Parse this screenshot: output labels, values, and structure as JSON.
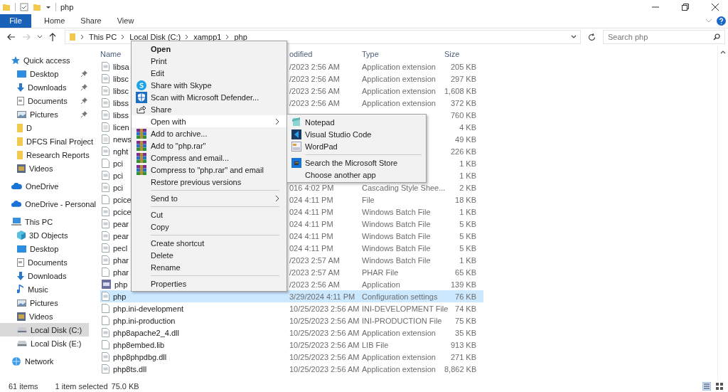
{
  "window": {
    "title": "php"
  },
  "ribbon": {
    "tabs": [
      {
        "label": "File",
        "kind": "file"
      },
      {
        "label": "Home",
        "kind": "tab"
      },
      {
        "label": "Share",
        "kind": "tab"
      },
      {
        "label": "View",
        "kind": "tab"
      }
    ]
  },
  "nav": {
    "back_disabled": false,
    "forward_disabled": true
  },
  "address": {
    "path": [
      "This PC",
      "Local Disk (C:)",
      "xampp1",
      "php"
    ]
  },
  "search": {
    "placeholder": "Search php"
  },
  "sidebar": {
    "sections": [
      {
        "label": "Quick access",
        "selected": false,
        "children": [
          {
            "label": "Desktop",
            "pinned": true,
            "selected": false
          },
          {
            "label": "Downloads",
            "pinned": true,
            "selected": false
          },
          {
            "label": "Documents",
            "pinned": true,
            "selected": false
          },
          {
            "label": "Pictures",
            "pinned": true,
            "selected": false
          },
          {
            "label": "D",
            "pinned": false,
            "selected": false
          },
          {
            "label": "DFCS Final Project",
            "pinned": false,
            "selected": false
          },
          {
            "label": "Research Reports",
            "pinned": false,
            "selected": false
          },
          {
            "label": "Videos",
            "pinned": false,
            "selected": false
          }
        ]
      },
      {
        "label": "OneDrive",
        "selected": false
      },
      {
        "label": "OneDrive - Personal",
        "selected": false
      },
      {
        "label": "This PC",
        "selected": false,
        "children": [
          {
            "label": "3D Objects",
            "selected": false
          },
          {
            "label": "Desktop",
            "selected": false
          },
          {
            "label": "Documents",
            "selected": false
          },
          {
            "label": "Downloads",
            "selected": false
          },
          {
            "label": "Music",
            "selected": false
          },
          {
            "label": "Pictures",
            "selected": false
          },
          {
            "label": "Videos",
            "selected": false
          },
          {
            "label": "Local Disk (C:)",
            "selected": true
          },
          {
            "label": "Local Disk (E:)",
            "selected": false
          }
        ]
      },
      {
        "label": "Network",
        "selected": false
      }
    ]
  },
  "file_list": {
    "columns": [
      "Name",
      "odified",
      "Type",
      "Size"
    ],
    "rows": [
      {
        "name": "libsa",
        "modified": "/2023 2:56 AM",
        "type": "Application extension",
        "size": "205 KB",
        "selected": false
      },
      {
        "name": "libsc",
        "modified": "/2023 2:56 AM",
        "type": "Application extension",
        "size": "297 KB",
        "selected": false
      },
      {
        "name": "libsc",
        "modified": "/2023 2:56 AM",
        "type": "Application extension",
        "size": "1,608 KB",
        "selected": false
      },
      {
        "name": "libss",
        "modified": "/2023 2:56 AM",
        "type": "Application extension",
        "size": "372 KB",
        "selected": false
      },
      {
        "name": "libss",
        "size": "760 KB",
        "selected": false
      },
      {
        "name": "licen",
        "size": "4 KB",
        "selected": false
      },
      {
        "name": "news",
        "size": "49 KB",
        "selected": false
      },
      {
        "name": "nght",
        "size": "226 KB",
        "selected": false
      },
      {
        "name": "pci",
        "size": "1 KB",
        "selected": false
      },
      {
        "name": "pci",
        "size": "1 KB",
        "selected": false
      },
      {
        "name": "pci",
        "modified": "016 4:02 PM",
        "type": "Cascading Style Shee...",
        "size": "2 KB",
        "selected": false
      },
      {
        "name": "pcice",
        "modified": "024 4:11 PM",
        "type": "File",
        "size": "18 KB",
        "selected": false
      },
      {
        "name": "pcice",
        "modified": "024 4:11 PM",
        "type": "Windows Batch File",
        "size": "1 KB",
        "selected": false
      },
      {
        "name": "pear",
        "modified": "024 4:11 PM",
        "type": "Windows Batch File",
        "size": "5 KB",
        "selected": false
      },
      {
        "name": "pear",
        "modified": "024 4:11 PM",
        "type": "Windows Batch File",
        "size": "5 KB",
        "selected": false
      },
      {
        "name": "pecl",
        "modified": "024 4:11 PM",
        "type": "Windows Batch File",
        "size": "5 KB",
        "selected": false
      },
      {
        "name": "phar",
        "modified": "/2023 2:57 AM",
        "type": "Windows Batch File",
        "size": "1 KB",
        "selected": false
      },
      {
        "name": "phar",
        "modified": "/2023 2:57 AM",
        "type": "PHAR File",
        "size": "65 KB",
        "selected": false
      },
      {
        "name": "php",
        "modified": "/2023 2:56 AM",
        "type": "Application",
        "size": "139 KB",
        "selected": false
      },
      {
        "name": "php",
        "modified": "3/29/2024 4:11 PM",
        "type": "Configuration settings",
        "size": "76 KB",
        "selected": true
      },
      {
        "name": "php.ini-development",
        "modified": "10/25/2023 2:56 AM",
        "type": "INI-DEVELOPMENT File",
        "size": "74 KB",
        "selected": false
      },
      {
        "name": "php.ini-production",
        "modified": "10/25/2023 2:56 AM",
        "type": "INI-PRODUCTION File",
        "size": "75 KB",
        "selected": false
      },
      {
        "name": "php8apache2_4.dll",
        "modified": "10/25/2023 2:56 AM",
        "type": "Application extension",
        "size": "35 KB",
        "selected": false
      },
      {
        "name": "php8embed.lib",
        "modified": "10/25/2023 2:56 AM",
        "type": "LIB File",
        "size": "913 KB",
        "selected": false
      },
      {
        "name": "php8phpdbg.dll",
        "modified": "10/25/2023 2:56 AM",
        "type": "Application extension",
        "size": "271 KB",
        "selected": false
      },
      {
        "name": "php8ts.dll",
        "modified": "10/25/2023 2:56 AM",
        "type": "Application extension",
        "size": "8,862 KB",
        "selected": false
      }
    ]
  },
  "context_menu": {
    "items": [
      {
        "kind": "item",
        "label": "Open",
        "default": true,
        "submenu": false,
        "selected": false
      },
      {
        "kind": "item",
        "label": "Print",
        "default": false,
        "submenu": false,
        "selected": false
      },
      {
        "kind": "item",
        "label": "Edit",
        "default": false,
        "submenu": false,
        "selected": false
      },
      {
        "kind": "item",
        "label": "Share with Skype",
        "default": false,
        "submenu": false,
        "selected": false
      },
      {
        "kind": "item",
        "label": "Scan with Microsoft Defender...",
        "default": false,
        "submenu": false,
        "selected": false
      },
      {
        "kind": "item",
        "label": "Share",
        "default": false,
        "submenu": false,
        "selected": false
      },
      {
        "kind": "item",
        "label": "Open with",
        "default": false,
        "submenu": true,
        "selected": true
      },
      {
        "kind": "item",
        "label": "Add to archive...",
        "default": false,
        "submenu": false,
        "selected": false
      },
      {
        "kind": "item",
        "label": "Add to \"php.rar\"",
        "default": false,
        "submenu": false,
        "selected": false
      },
      {
        "kind": "item",
        "label": "Compress and email...",
        "default": false,
        "submenu": false,
        "selected": false
      },
      {
        "kind": "item",
        "label": "Compress to \"php.rar\" and email",
        "default": false,
        "submenu": false,
        "selected": false
      },
      {
        "kind": "item",
        "label": "Restore previous versions",
        "default": false,
        "submenu": false,
        "selected": false
      },
      {
        "kind": "separator"
      },
      {
        "kind": "item",
        "label": "Send to",
        "default": false,
        "submenu": true,
        "selected": false
      },
      {
        "kind": "separator"
      },
      {
        "kind": "item",
        "label": "Cut",
        "default": false,
        "submenu": false,
        "selected": false
      },
      {
        "kind": "item",
        "label": "Copy",
        "default": false,
        "submenu": false,
        "selected": false
      },
      {
        "kind": "separator"
      },
      {
        "kind": "item",
        "label": "Create shortcut",
        "default": false,
        "submenu": false,
        "selected": false
      },
      {
        "kind": "item",
        "label": "Delete",
        "default": false,
        "submenu": false,
        "selected": false
      },
      {
        "kind": "item",
        "label": "Rename",
        "default": false,
        "submenu": false,
        "selected": false
      },
      {
        "kind": "separator"
      },
      {
        "kind": "item",
        "label": "Properties",
        "default": false,
        "submenu": false,
        "selected": false
      }
    ]
  },
  "open_with_menu": {
    "items": [
      {
        "kind": "item",
        "label": "Notepad",
        "selected": false
      },
      {
        "kind": "item",
        "label": "Visual Studio Code",
        "selected": false
      },
      {
        "kind": "item",
        "label": "WordPad",
        "selected": false
      },
      {
        "kind": "separator"
      },
      {
        "kind": "item",
        "label": "Search the Microsoft Store",
        "selected": false
      },
      {
        "kind": "item",
        "label": "Choose another app",
        "selected": false
      }
    ]
  },
  "status_bar": {
    "item_count": "61 items",
    "selection": "1 item selected",
    "size": "75.0 KB"
  }
}
